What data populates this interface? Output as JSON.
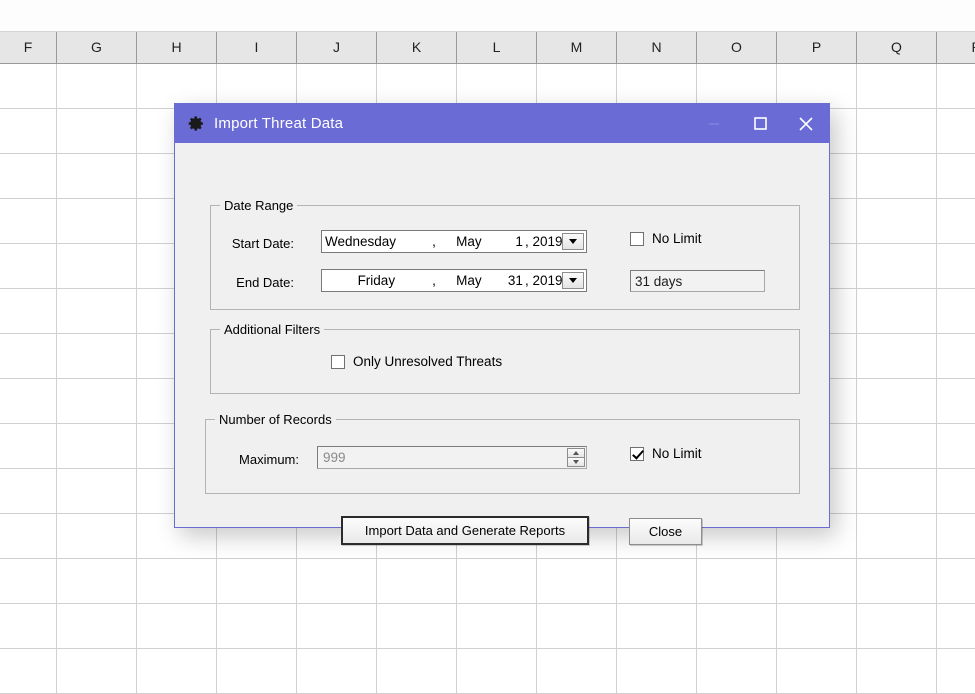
{
  "spreadsheet": {
    "columns": [
      "F",
      "G",
      "H",
      "I",
      "J",
      "K",
      "L",
      "M",
      "N",
      "O",
      "P",
      "Q",
      "R"
    ]
  },
  "dialog": {
    "title": "Import Threat Data",
    "icon": "gear-icon",
    "accent_color": "#6b6bd6",
    "window_buttons": {
      "minimize": "–",
      "maximize": "☐",
      "close": "✕"
    },
    "date_range": {
      "legend": "Date Range",
      "start_label": "Start Date:",
      "start_value": {
        "dayname": "Wednesday",
        "comma": ",",
        "month": "May",
        "day": "1",
        "year": ", 2019"
      },
      "end_label": "End Date:",
      "end_value": {
        "dayname": "Friday",
        "comma": ",",
        "month": "May",
        "day": "31",
        "year": ", 2019"
      },
      "no_limit_label": "No Limit",
      "no_limit_checked": false,
      "duration_value": "31 days"
    },
    "additional_filters": {
      "legend": "Additional Filters",
      "only_unresolved_label": "Only Unresolved Threats",
      "only_unresolved_checked": false
    },
    "number_of_records": {
      "legend": "Number of Records",
      "maximum_label": "Maximum:",
      "maximum_value": "999",
      "no_limit_label": "No Limit",
      "no_limit_checked": true
    },
    "buttons": {
      "primary": "Import Data and Generate Reports",
      "close": "Close"
    }
  }
}
